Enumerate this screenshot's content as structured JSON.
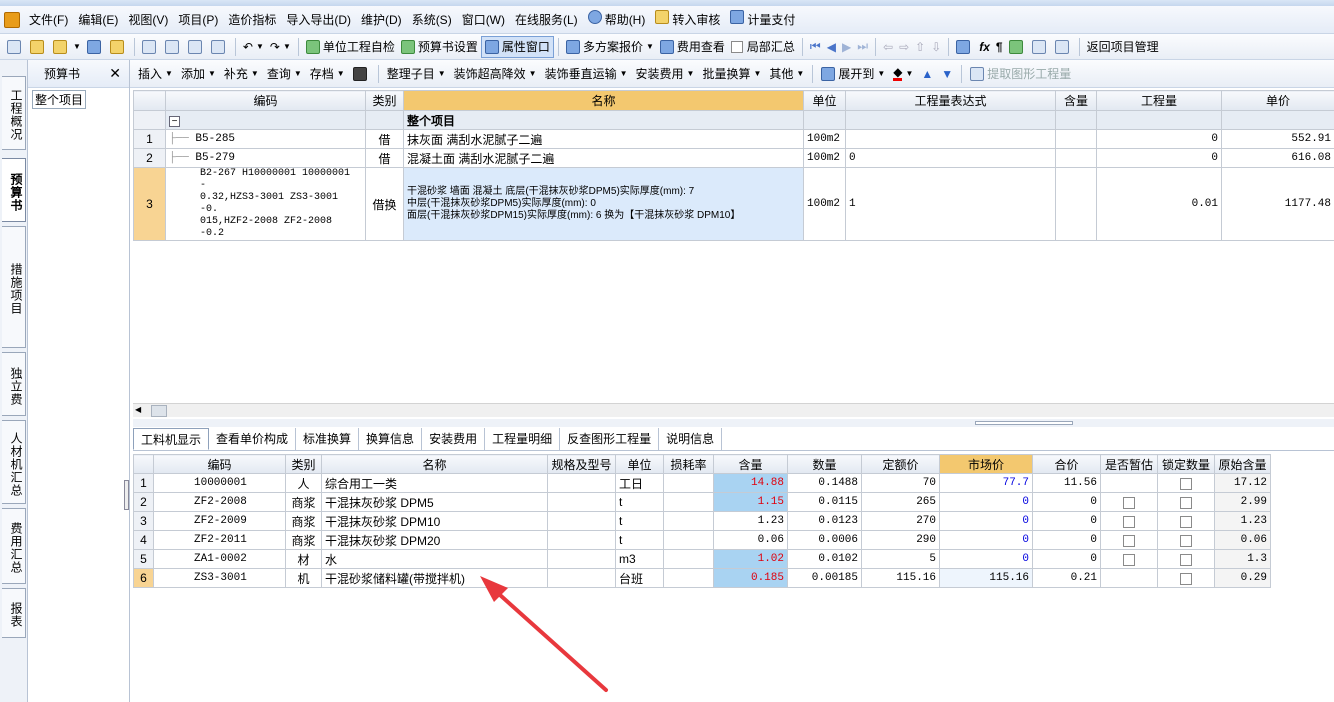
{
  "menu": [
    "文件(F)",
    "编辑(E)",
    "视图(V)",
    "项目(P)",
    "造价指标",
    "导入导出(D)",
    "维护(D)",
    "系统(S)",
    "窗口(W)",
    "在线服务(L)",
    "帮助(H)",
    "转入审核",
    "计量支付"
  ],
  "toolbar": {
    "self_check": "单位工程自检",
    "book_settings": "预算书设置",
    "property_window": "属性窗口",
    "multi_quote": "多方案报价",
    "fee_view": "费用查看",
    "partial_summary": "局部汇总",
    "return_project": "返回项目管理"
  },
  "left_tabs": [
    "工程概况",
    "预算书",
    "措施项目",
    "独立费",
    "人材机汇总",
    "费用汇总",
    "报表"
  ],
  "tree": {
    "title": "预算书",
    "close": "✕",
    "root": "整个项目"
  },
  "subtoolbar": {
    "insert": "插入",
    "add": "添加",
    "supplement": "补充",
    "query": "查询",
    "archive": "存档",
    "organize": "整理子目",
    "decor_height": "装饰超高降效",
    "decor_vertical": "装饰垂直运输",
    "install_fee": "安装费用",
    "batch_convert": "批量换算",
    "other": "其他",
    "expand_to": "展开到",
    "extract_qty": "提取图形工程量"
  },
  "grid1": {
    "headers": {
      "code": "编码",
      "cat": "类别",
      "name": "名称",
      "unit": "单位",
      "expr": "工程量表达式",
      "content": "含量",
      "qty": "工程量",
      "price": "单价"
    },
    "group_label": "整个项目",
    "group_toggle": "−",
    "rows": [
      {
        "num": "1",
        "code": "B5-285",
        "cat": "借",
        "name": "抹灰面 满刮水泥腻子二遍",
        "unit": "100m2",
        "expr": "",
        "content": "",
        "qty": "0",
        "price": "552.91"
      },
      {
        "num": "2",
        "code": "B5-279",
        "cat": "借",
        "name": "混凝土面 满刮水泥腻子二遍",
        "unit": "100m2",
        "expr": "0",
        "content": "",
        "qty": "0",
        "price": "616.08"
      },
      {
        "num": "3",
        "code_lines": [
          "B2-267 H10000001 10000001 -",
          "0.32,HZS3-3001 ZS3-3001 -0.",
          "015,HZF2-2008 ZF2-2008 -0.2"
        ],
        "cat": "借换",
        "name_lines": [
          "干混砂浆 墙面 混凝土  底层(干混抹灰砂浆DPM5)实际厚度(mm): 7",
          "中层(干混抹灰砂浆DPM5)实际厚度(mm): 0",
          "面层(干混抹灰砂浆DPM15)实际厚度(mm): 6 换为【干混抹灰砂浆 DPM10】"
        ],
        "unit": "100m2",
        "expr": "1",
        "content": "",
        "qty": "0.01",
        "price": "1177.48"
      }
    ]
  },
  "bottom_tabs": [
    "工料机显示",
    "查看单价构成",
    "标准换算",
    "换算信息",
    "安装费用",
    "工程量明细",
    "反查图形工程量",
    "说明信息"
  ],
  "grid2": {
    "headers": {
      "code": "编码",
      "cat": "类别",
      "name": "名称",
      "spec": "规格及型号",
      "unit": "单位",
      "loss": "损耗率",
      "content": "含量",
      "qty": "数量",
      "quota": "定额价",
      "market": "市场价",
      "total": "合价",
      "est": "是否暂估",
      "lock": "锁定数量",
      "orig": "原始含量"
    },
    "rows": [
      {
        "num": "1",
        "code": "10000001",
        "cat": "人",
        "name": "综合用工一类",
        "spec": "",
        "unit": "工日",
        "loss": "",
        "content": "14.88",
        "qty": "0.1488",
        "quota": "70",
        "market": "77.7",
        "total": "11.56",
        "orig": "17.12",
        "est": false
      },
      {
        "num": "2",
        "code": "ZF2-2008",
        "cat": "商浆",
        "name": "干混抹灰砂浆 DPM5",
        "spec": "",
        "unit": "t",
        "loss": "",
        "content": "1.15",
        "qty": "0.0115",
        "quota": "265",
        "market": "0",
        "total": "0",
        "orig": "2.99",
        "est": true
      },
      {
        "num": "3",
        "code": "ZF2-2009",
        "cat": "商浆",
        "name": "干混抹灰砂浆 DPM10",
        "spec": "",
        "unit": "t",
        "loss": "",
        "content": "1.23",
        "qty": "0.0123",
        "quota": "270",
        "market": "0",
        "total": "0",
        "orig": "1.23",
        "est": true
      },
      {
        "num": "4",
        "code": "ZF2-2011",
        "cat": "商浆",
        "name": "干混抹灰砂浆 DPM20",
        "spec": "",
        "unit": "t",
        "loss": "",
        "content": "0.06",
        "qty": "0.0006",
        "quota": "290",
        "market": "0",
        "total": "0",
        "orig": "0.06",
        "est": true
      },
      {
        "num": "5",
        "code": "ZA1-0002",
        "cat": "材",
        "name": "水",
        "spec": "",
        "unit": "m3",
        "loss": "",
        "content": "1.02",
        "qty": "0.0102",
        "quota": "5",
        "market": "0",
        "total": "0",
        "orig": "1.3",
        "est": true
      },
      {
        "num": "6",
        "code": "ZS3-3001",
        "cat": "机",
        "name": "干混砂浆储料罐(带搅拌机)",
        "spec": "",
        "unit": "台班",
        "loss": "",
        "content": "0.185",
        "qty": "0.00185",
        "quota": "115.16",
        "market": "115.16",
        "total": "0.21",
        "orig": "0.29",
        "est": false
      }
    ]
  },
  "colors": {
    "accent_header": "#f3c86f",
    "highlight_blue": "#a9d3f2",
    "red_value": "#e0000c",
    "blue_value": "#0000e0",
    "annotation_arrow": "#e8383d"
  }
}
